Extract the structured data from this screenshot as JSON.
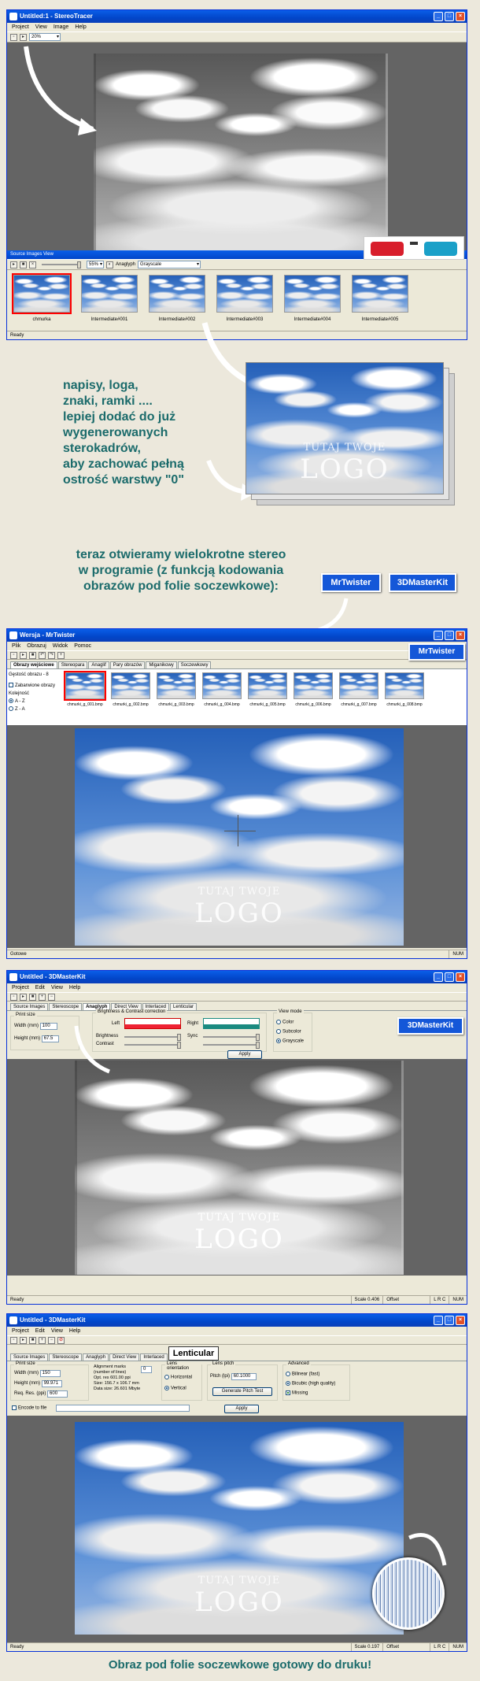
{
  "win1": {
    "title": "Untitled:1 - StereoTracer",
    "menu": [
      "Project",
      "View",
      "Image",
      "Help"
    ],
    "zoom": "20%",
    "panel_title": "Source Images View",
    "panel_zoom": "55%",
    "anaglyph_label": "Anaglyph",
    "anaglyph_mode": "Grayscale",
    "thumbs": [
      "chmurka",
      "Intermediate#001",
      "Intermediate#002",
      "Intermediate#003",
      "Intermediate#004",
      "Intermediate#005"
    ],
    "status": "Ready"
  },
  "annot1": {
    "lines": [
      "napisy, loga,",
      "znaki, ramki ....",
      "lepiej dodać do już",
      "wygenerowanych",
      "sterokadrów,",
      "aby zachować pełną",
      "ostrość warstwy \"0\""
    ],
    "logo_small": "TUTAJ TWOJE",
    "logo_big": "LOGO"
  },
  "annot2": {
    "lines": [
      "teraz otwieramy wielokrotne stereo",
      "w programie (z funkcją kodowania",
      "obrazów pod folie soczewkowe):"
    ],
    "btn_mrtwister": "MrTwister",
    "btn_3dmk": "3DMasterKit"
  },
  "win2": {
    "title": "Wersja - MrTwister",
    "menu": [
      "Plik",
      "Obrazuj",
      "Widok",
      "Pomoc"
    ],
    "brand": "MrTwister",
    "tabs": [
      "Obrazy wejściowe",
      "Stereopara",
      "Anaglif",
      "Pary obrazów",
      "Miganikowy",
      "Soczewkowy"
    ],
    "side_label": "Gęstość obrazu - 8",
    "side_check": "Zabarwione obrazy",
    "side_order_label": "Kolejność",
    "side_opts": [
      "A - Z",
      "Z - A"
    ],
    "thumbs": [
      "chmurki_g_001.bmp",
      "chmurki_g_002.bmp",
      "chmurki_g_003.bmp",
      "chmurki_g_004.bmp",
      "chmurki_g_005.bmp",
      "chmurki_g_006.bmp",
      "chmurki_g_007.bmp",
      "chmurki_g_008.bmp"
    ],
    "logo_small": "TUTAJ TWOJE",
    "logo_big": "LOGO",
    "status": "Gotowe",
    "num": "NUM"
  },
  "win3": {
    "title": "Untitled - 3DMasterKit",
    "menu": [
      "Project",
      "Edit",
      "View",
      "Help"
    ],
    "tabs": [
      "Source Images",
      "Stereoscope",
      "Anaglyph",
      "Direct View",
      "Interlaced",
      "Lenticular"
    ],
    "brand": "3DMasterKit",
    "print_size": "Print size",
    "width_label": "Width (mm)",
    "width_val": "100",
    "height_label": "Height (mm)",
    "height_val": "67.5",
    "bc_title": "Brightness & Contrast correction",
    "left": "Left",
    "right": "Right",
    "brightness": "Brightness",
    "contrast": "Contrast",
    "sync": "Sync",
    "view_mode": "View mode",
    "vm_opts": [
      "Color",
      "Subcolor",
      "Grayscale"
    ],
    "apply": "Apply",
    "logo_small": "TUTAJ TWOJE",
    "logo_big": "LOGO",
    "status": "Ready",
    "scale": "Scale  0.406",
    "offset": "Offset",
    "lrc": "L  R  C",
    "num": "NUM"
  },
  "win4": {
    "title": "Untitled - 3DMasterKit",
    "menu": [
      "Project",
      "Edit",
      "View",
      "Help"
    ],
    "tabs": [
      "Source Images",
      "Stereoscope",
      "Anaglyph",
      "Direct View",
      "Interlaced"
    ],
    "tab_big": "Lenticular",
    "print_size": "Print size",
    "width_label": "Width (mm)",
    "width_val": "150",
    "height_label": "Height (mm)",
    "height_val": "99.971",
    "res_label": "Req. Res. (ppi)",
    "res_val": "600",
    "align_label": "Alignment marks (number of lines)",
    "align_val": "0",
    "opt_res": "Opt. res 601.00 ppi",
    "size": "Size: 156.7 x 106.7 mm",
    "data_size": "Data size: 26.601 Mbyte",
    "lens_orient": "Lens orientation",
    "orient_opts": [
      "Horizontal",
      "Vertical"
    ],
    "lens_pitch": "Lens pitch",
    "pitch_label": "Pitch (lpi)",
    "pitch_val": "60.1000",
    "gen_btn": "Generate Pitch Test",
    "advanced": "Advanced",
    "adv_opts": [
      "Bilinear (fast)",
      "Bicubic (high quality)"
    ],
    "missing": "Missing",
    "encode": "Encode to file",
    "apply": "Apply",
    "logo_small": "TUTAJ TWOJE",
    "logo_big": "LOGO",
    "status": "Ready",
    "scale": "Scale  0.197",
    "offset": "Offset",
    "lrc": "L  R  C",
    "num": "NUM"
  },
  "footer": "Obraz pod folie soczewkowe gotowy do druku!"
}
